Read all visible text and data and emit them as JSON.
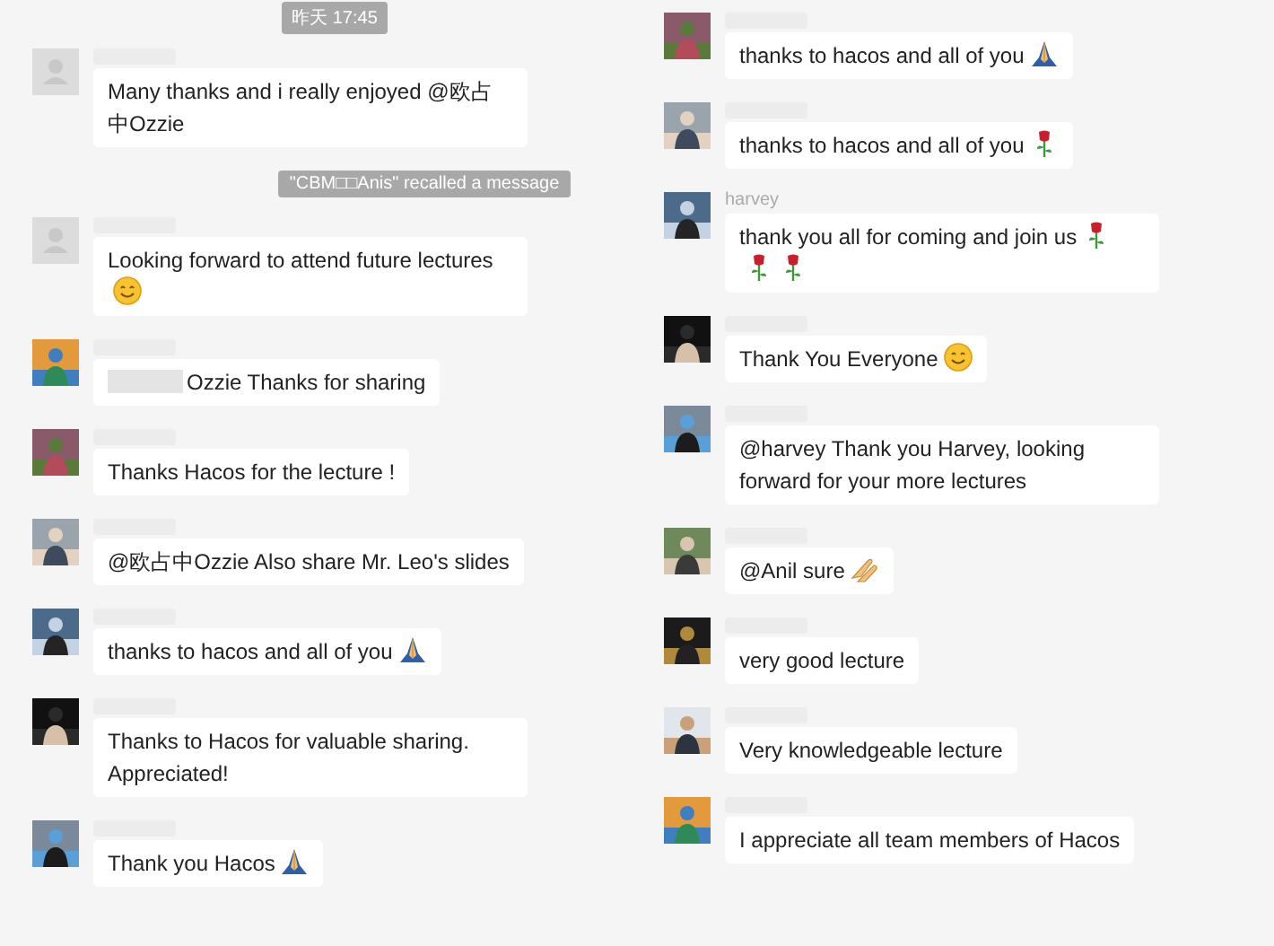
{
  "columns": [
    {
      "header": {
        "kind": "time",
        "text": "昨天 17:45"
      },
      "items": [
        {
          "kind": "message",
          "avatar": {
            "kind": "default"
          },
          "text": "Many thanks and i really enjoyed @欧占中Ozzie"
        },
        {
          "kind": "notice",
          "text": "\"CBM□□Anis\" recalled a message"
        },
        {
          "kind": "message",
          "avatar": {
            "kind": "default"
          },
          "text": "Looking forward to attend future lectures",
          "emojis": [
            {
              "kind": "smile"
            }
          ]
        },
        {
          "kind": "message",
          "avatar": {
            "kind": "picture"
          },
          "redacted_prefix": true,
          "text": "Ozzie  Thanks for sharing"
        },
        {
          "kind": "message",
          "avatar": {
            "kind": "picture"
          },
          "text": "Thanks Hacos for the lecture !"
        },
        {
          "kind": "message",
          "avatar": {
            "kind": "picture"
          },
          "text": "@欧占中Ozzie Also share Mr. Leo's slides"
        },
        {
          "kind": "message",
          "avatar": {
            "kind": "picture"
          },
          "text": "thanks to hacos and all of you",
          "emojis": [
            {
              "kind": "pray"
            }
          ]
        },
        {
          "kind": "message",
          "avatar": {
            "kind": "picture"
          },
          "text": "Thanks to Hacos for valuable sharing. Appreciated!"
        },
        {
          "kind": "message",
          "avatar": {
            "kind": "picture"
          },
          "text": "Thank you Hacos",
          "emojis": [
            {
              "kind": "pray"
            }
          ]
        }
      ]
    },
    {
      "items": [
        {
          "kind": "message",
          "avatar": {
            "kind": "picture"
          },
          "text": "thanks to hacos and all of you",
          "emojis": [
            {
              "kind": "pray"
            }
          ]
        },
        {
          "kind": "message",
          "avatar": {
            "kind": "picture"
          },
          "text": "thanks to hacos and all of you",
          "emojis": [
            {
              "kind": "rose"
            }
          ]
        },
        {
          "kind": "message",
          "avatar": {
            "kind": "picture"
          },
          "sender": "harvey",
          "text": "thank you all for coming and join us",
          "emojis": [
            {
              "kind": "rose"
            },
            {
              "kind": "rose"
            },
            {
              "kind": "rose"
            }
          ]
        },
        {
          "kind": "message",
          "avatar": {
            "kind": "picture"
          },
          "text": "Thank You Everyone",
          "emojis": [
            {
              "kind": "smile"
            }
          ]
        },
        {
          "kind": "message",
          "avatar": {
            "kind": "picture"
          },
          "text": "@harvey Thank you Harvey, looking forward for your more lectures"
        },
        {
          "kind": "message",
          "avatar": {
            "kind": "picture"
          },
          "text": "@Anil sure",
          "emojis": [
            {
              "kind": "hands"
            }
          ]
        },
        {
          "kind": "message",
          "avatar": {
            "kind": "picture"
          },
          "text": "very good lecture"
        },
        {
          "kind": "message",
          "avatar": {
            "kind": "picture"
          },
          "text": "Very knowledgeable lecture"
        },
        {
          "kind": "message",
          "avatar": {
            "kind": "picture"
          },
          "text": "I appreciate all team members of Hacos"
        }
      ]
    }
  ]
}
